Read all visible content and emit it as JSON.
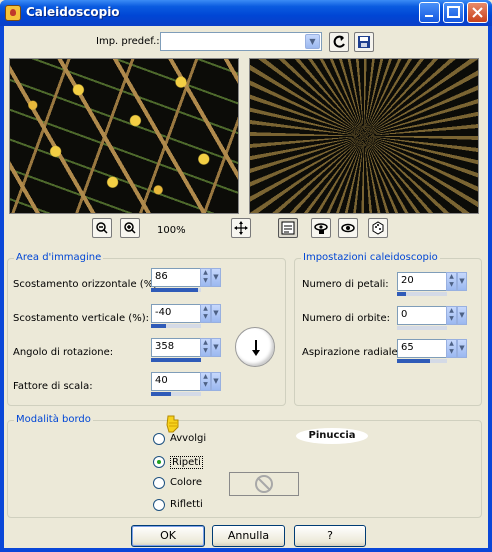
{
  "window": {
    "title": "Caleidoscopio",
    "minimize_label": "_",
    "maximize_label": "□",
    "close_label": "×"
  },
  "preset": {
    "label": "Imp. predef.:",
    "value": "",
    "arrow": "▼"
  },
  "toolbar": {
    "zoom_level": "100%"
  },
  "image_area": {
    "title": "Area d'immagine",
    "fields": [
      {
        "label": "Scostamento orizzontale (%):",
        "value": "86",
        "fill": 0.93
      },
      {
        "label": "Scostamento verticale (%):",
        "value": "-40",
        "fill": 0.3
      },
      {
        "label": "Angolo di rotazione:",
        "value": "358",
        "fill": 0.99
      },
      {
        "label": "Fattore di scala:",
        "value": "40",
        "fill": 0.4
      }
    ]
  },
  "kaleido": {
    "title": "Impostazioni caleidoscopio",
    "fields": [
      {
        "label": "Numero di petali:",
        "value": "20",
        "fill": 0.18
      },
      {
        "label": "Numero di orbite:",
        "value": "0",
        "fill": 0.0
      },
      {
        "label": "Aspirazione radiale:",
        "value": "65",
        "fill": 0.65
      }
    ]
  },
  "edge_mode": {
    "title": "Modalità bordo",
    "options": [
      {
        "label": "Avvolgi",
        "checked": false
      },
      {
        "label": "Ripeti",
        "checked": true
      },
      {
        "label": "Colore",
        "checked": false
      },
      {
        "label": "Rifletti",
        "checked": false
      }
    ]
  },
  "watermark": "Pinuccia",
  "buttons": {
    "ok": "OK",
    "cancel": "Annulla",
    "help": "?"
  },
  "colors": {
    "title_bar": "#0a5be0",
    "group_title": "#0046d5",
    "spin_fill": "#2f5bb8",
    "radio_dot": "#21a121"
  },
  "icons": {
    "app": "caleidoscope-app-icon",
    "zoom_out": "zoom-out-icon",
    "zoom_in": "zoom-in-icon",
    "pan": "pan-move-icon",
    "proof": "proof-toggle-icon",
    "reset": "reset-icon",
    "save_preset": "save-floppy-icon"
  }
}
